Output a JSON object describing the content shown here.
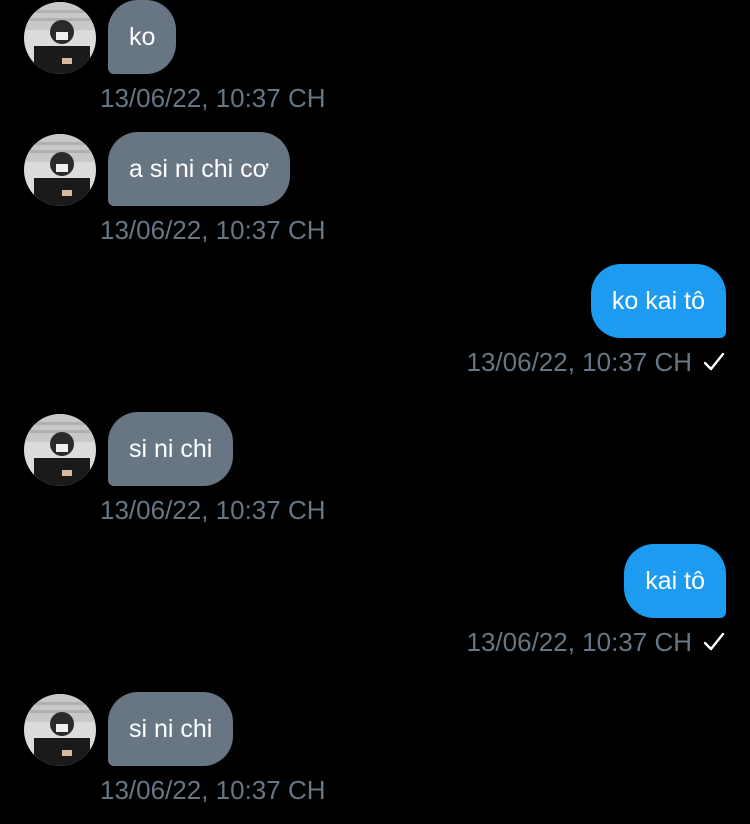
{
  "messages": [
    {
      "direction": "in",
      "text": "ko",
      "timestamp": "13/06/22, 10:37 CH"
    },
    {
      "direction": "in",
      "text": "a si ni chi cơ",
      "timestamp": "13/06/22, 10:37 CH"
    },
    {
      "direction": "out",
      "text": "ko kai tô",
      "timestamp": "13/06/22, 10:37 CH",
      "status_icon": "check-icon"
    },
    {
      "direction": "in",
      "text": "si ni chi",
      "timestamp": "13/06/22, 10:37 CH"
    },
    {
      "direction": "out",
      "text": "kai tô",
      "timestamp": "13/06/22, 10:37 CH",
      "status_icon": "check-icon"
    },
    {
      "direction": "in",
      "text": "si ni chi",
      "timestamp": "13/06/22, 10:37 CH"
    }
  ],
  "colors": {
    "background": "#000000",
    "incoming_bubble": "#687684",
    "outgoing_bubble": "#1d9bf0",
    "timestamp": "#687684",
    "message_text": "#ffffff"
  }
}
